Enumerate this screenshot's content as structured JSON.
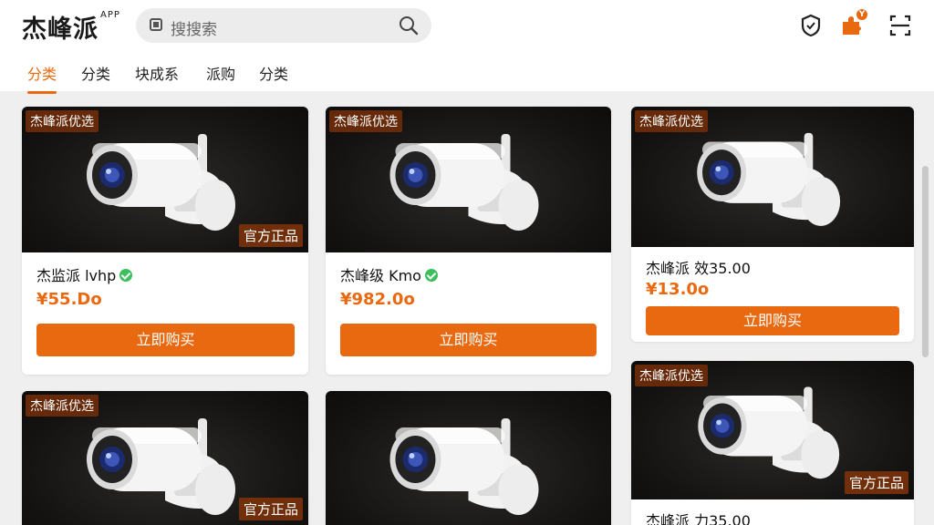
{
  "app": {
    "name": "杰峰派",
    "sup": "APP"
  },
  "search": {
    "placeholder": "搜搜索"
  },
  "icons": [
    "shield-icon",
    "puzzle-icon",
    "scan-icon",
    "search-icon"
  ],
  "badge": {
    "text": "Y",
    "color": "#e8690f"
  },
  "tabs": [
    {
      "label": "分类",
      "active": true
    },
    {
      "label": "分类",
      "active": false
    },
    {
      "label": "块成系",
      "active": false
    },
    {
      "label": "派购",
      "active": false
    },
    {
      "label": "分类",
      "active": false
    }
  ],
  "accent": "#e8690f",
  "products": [
    {
      "brand_tag": "杰峰派优选",
      "official_tag": "官方正品",
      "title": "杰监派 lvhp",
      "verified": true,
      "price": "¥55.Do",
      "buy_label": "立即购买"
    },
    {
      "brand_tag": "杰峰派优选",
      "official_tag": "",
      "title": "杰峰级 Kmo",
      "verified": true,
      "price": "¥982.0o",
      "buy_label": "立即购买"
    },
    {
      "brand_tag": "杰峰派优选",
      "official_tag": "",
      "title": "杰峰派 效35.00",
      "verified": false,
      "price": "¥13.0o",
      "buy_label": "立即购买"
    },
    {
      "brand_tag": "杰峰派优选",
      "official_tag": "官方正品",
      "title": "",
      "verified": false,
      "price": "",
      "buy_label": ""
    },
    {
      "brand_tag": "",
      "official_tag": "",
      "title": "",
      "verified": false,
      "price": "",
      "buy_label": ""
    },
    {
      "brand_tag": "杰峰派优选",
      "official_tag": "官方正品",
      "title": "杰峰派 力35.00",
      "verified": false,
      "price": "",
      "buy_label": ""
    }
  ]
}
